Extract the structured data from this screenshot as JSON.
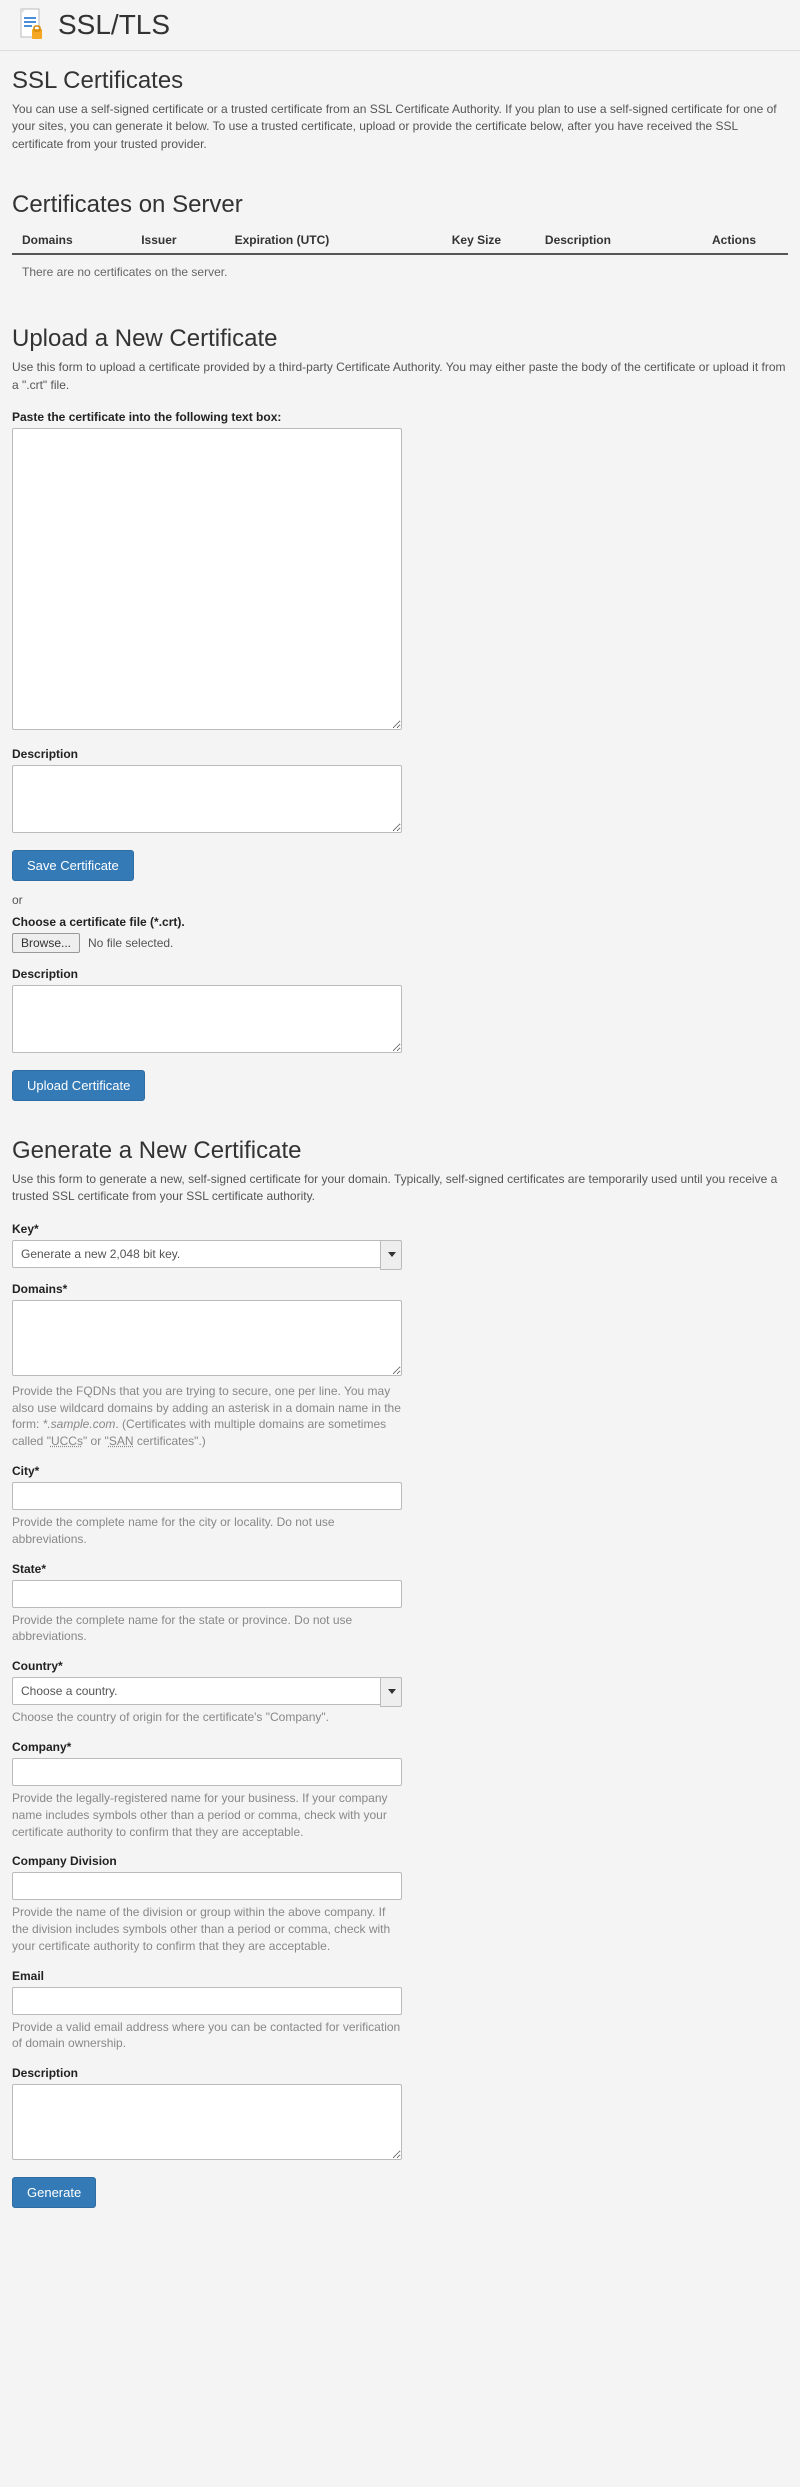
{
  "header": {
    "title": "SSL/TLS"
  },
  "ssl_certs": {
    "heading": "SSL Certificates",
    "desc": "You can use a self-signed certificate or a trusted certificate from an SSL Certificate Authority. If you plan to use a self-signed certificate for one of your sites, you can generate it below. To use a trusted certificate, upload or provide the certificate below, after you have received the SSL certificate from your trusted provider."
  },
  "certs_on_server": {
    "heading": "Certificates on Server",
    "cols": {
      "domains": "Domains",
      "issuer": "Issuer",
      "expiration": "Expiration (UTC)",
      "key_size": "Key Size",
      "description": "Description",
      "actions": "Actions"
    },
    "empty": "There are no certificates on the server."
  },
  "upload": {
    "heading": "Upload a New Certificate",
    "desc": "Use this form to upload a certificate provided by a third-party Certificate Authority. You may either paste the body of the certificate or upload it from a \".crt\" file.",
    "paste_label": "Paste the certificate into the following text box:",
    "desc_label": "Description",
    "save_btn": "Save Certificate",
    "or": "or",
    "choose_label": "Choose a certificate file (*.crt).",
    "browse": "Browse...",
    "no_file": "No file selected.",
    "desc2_label": "Description",
    "upload_btn": "Upload Certificate"
  },
  "generate": {
    "heading": "Generate a New Certificate",
    "desc": "Use this form to generate a new, self-signed certificate for your domain. Typically, self-signed certificates are temporarily used until you receive a trusted SSL certificate from your SSL certificate authority.",
    "key_label": "Key*",
    "key_option": "Generate a new 2,048 bit key.",
    "domains_label": "Domains*",
    "domains_help_pre": "Provide the FQDNs that you are trying to secure, one per line. You may also use wildcard domains by adding an asterisk in a domain name in the form: ",
    "domains_help_em": "*.sample.com",
    "domains_help_post": ". (Certificates with multiple domains are sometimes called \"",
    "domains_help_ucc": "UCCs",
    "domains_help_mid": "\" or \"",
    "domains_help_san": "SAN",
    "domains_help_end": " certificates\".)",
    "city_label": "City*",
    "city_help": "Provide the complete name for the city or locality. Do not use abbreviations.",
    "state_label": "State*",
    "state_help": "Provide the complete name for the state or province. Do not use abbreviations.",
    "country_label": "Country*",
    "country_option": "Choose a country.",
    "country_help": "Choose the country of origin for the certificate's \"Company\".",
    "company_label": "Company*",
    "company_help": "Provide the legally-registered name for your business. If your company name includes symbols other than a period or comma, check with your certificate authority to confirm that they are acceptable.",
    "division_label": "Company Division",
    "division_help": "Provide the name of the division or group within the above company. If the division includes symbols other than a period or comma, check with your certificate authority to confirm that they are acceptable.",
    "email_label": "Email",
    "email_help": "Provide a valid email address where you can be contacted for verification of domain ownership.",
    "gdesc_label": "Description",
    "generate_btn": "Generate"
  }
}
